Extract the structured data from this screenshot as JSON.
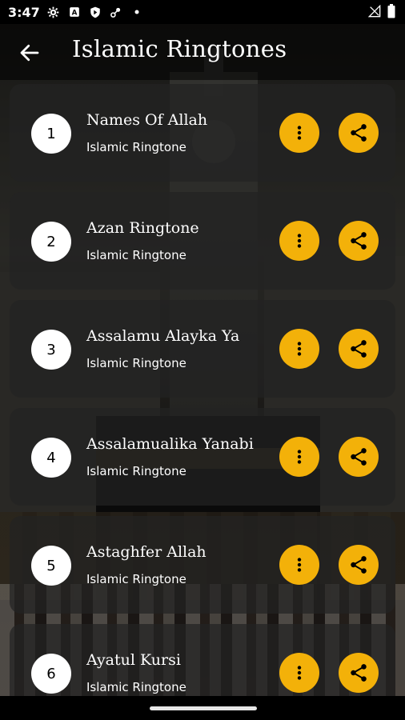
{
  "status_bar": {
    "time": "3:47",
    "icons": [
      "gear-icon",
      "font-icon",
      "shield-icon",
      "settings-satellite-icon",
      "dot-icon",
      "signal-icon",
      "battery-icon"
    ]
  },
  "app_bar": {
    "title": "Islamic Ringtones",
    "back_icon": "arrow-left-icon"
  },
  "ringtones": [
    {
      "number": "1",
      "name": "Names Of Allah",
      "subtitle": "Islamic Ringtone"
    },
    {
      "number": "2",
      "name": "Azan Ringtone",
      "subtitle": "Islamic Ringtone"
    },
    {
      "number": "3",
      "name": "Assalamu Alayka Ya",
      "subtitle": "Islamic Ringtone"
    },
    {
      "number": "4",
      "name": "Assalamualika Yanabi",
      "subtitle": "Islamic Ringtone"
    },
    {
      "number": "5",
      "name": "Astaghfer Allah",
      "subtitle": "Islamic Ringtone"
    },
    {
      "number": "6",
      "name": "Ayatul Kursi",
      "subtitle": "Islamic Ringtone"
    }
  ],
  "colors": {
    "accent": "#f3b109",
    "card_background": "#222222",
    "text": "#ffffff"
  }
}
